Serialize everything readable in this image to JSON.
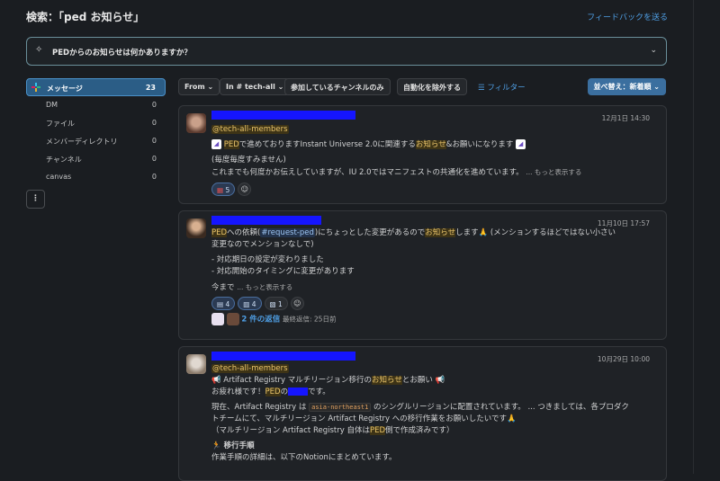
{
  "header": {
    "title": "検索：「ped お知らせ」",
    "feedback": "フィードバックを送る"
  },
  "ai_question": {
    "text": "PEDからのお知らせは何かありますか？"
  },
  "sidebar": {
    "items": [
      {
        "label": "メッセージ",
        "count": "23"
      },
      {
        "label": "DM",
        "count": "0"
      },
      {
        "label": "ファイル",
        "count": "0"
      },
      {
        "label": "メンバーディレクトリ",
        "count": "0"
      },
      {
        "label": "チャンネル",
        "count": "0"
      },
      {
        "label": "canvas",
        "count": "0"
      }
    ],
    "more": "⋮"
  },
  "filters": {
    "from": "From ⌄",
    "in": "In # tech-all ⌄",
    "joined": "参加しているチャンネルのみ",
    "exclude_auto": "自動化を除外する",
    "filter": "フィルター",
    "sort": "並べ替え：新着順 ⌄"
  },
  "messages": [
    {
      "timestamp": "12月1日 14:30",
      "mention": "@tech-all-members",
      "line1_ped": "PED",
      "line1_mid": "で進めておりますInstant Universe 2.0に関連する",
      "line1_hl": "お知らせ",
      "line1_end": "&お願いになります",
      "line2": "(毎度毎度すみません)",
      "line3": "これまでも何度かお伝えしていますが、IU 2.0ではマニフェストの共通化を進めています。",
      "more": "... もっと表示する",
      "reaction_count": "5"
    },
    {
      "timestamp": "11月10日 17:57",
      "l1_ped": "PED",
      "l1_a": "への依頼(",
      "l1_chan": "#request-ped",
      "l1_b": ")にちょっとした変更があるので",
      "l1_hl": "お知らせ",
      "l1_c": "します🙏 (メンションするほどではない小さい",
      "l2": "変更なのでメンションなしで)",
      "b1": "- 対応期日の設定が変わりました",
      "b2": "- 対応開始のタイミングに変更があります",
      "l3": "今まで",
      "more": "... もっと表示する",
      "r1": "4",
      "r2": "4",
      "r3": "1",
      "replies": "2 件の返信",
      "last_reply": "最終返信: 25日前"
    },
    {
      "timestamp": "10月29日 10:00",
      "mention": "@tech-all-members",
      "l1_a": "Artifact Registry マルチリージョン移行の",
      "l1_hl": "お知らせ",
      "l1_b": "とお願い",
      "l2_a": "お疲れ様です！",
      "l2_ped": "PED",
      "l2_b": "の",
      "l2_c": "です。",
      "l3_a": "現在、Artifact Registry は",
      "l3_code": "asia-northeast1",
      "l3_b": "のシングルリージョンに配置されています。",
      "l3_more": "... つきましては、各プロダク",
      "l4": "トチームにて、マルチリージョン Artifact Registry への移行作業をお願いしたいです🙏",
      "l5_a": "（マルチリージョン Artifact Registry 自体は",
      "l5_ped": "PED",
      "l5_b": "側で作成済みです）",
      "h": "移行手順",
      "l6": "作業手順の詳細は、以下のNotionにまとめています。"
    }
  ]
}
